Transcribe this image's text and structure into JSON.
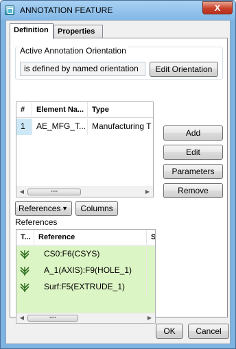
{
  "window": {
    "title": "ANNOTATION FEATURE",
    "close_label": "X"
  },
  "tabs": [
    {
      "label": "Definition",
      "active": true
    },
    {
      "label": "Properties",
      "active": false
    }
  ],
  "orientation": {
    "group_label": "Active Annotation Orientation",
    "value": "is defined by named orientation",
    "edit_button": "Edit Orientation"
  },
  "elements_table": {
    "columns": [
      "#",
      "Element Na...",
      "Type"
    ],
    "rows": [
      {
        "num": "1",
        "name": "AE_MFG_T...",
        "type": "Manufacturing T"
      }
    ]
  },
  "element_actions": {
    "add": "Add",
    "edit": "Edit",
    "parameters": "Parameters",
    "remove": "Remove"
  },
  "toolbar": {
    "references_dropdown": "References",
    "columns_button": "Columns"
  },
  "references_section": {
    "label": "References",
    "columns": [
      "T...",
      "Reference",
      "S"
    ],
    "rows": [
      {
        "icon": "datum-reference-icon",
        "reference": "CS0:F6(CSYS)"
      },
      {
        "icon": "datum-reference-icon",
        "reference": "A_1(AXIS):F9(HOLE_1)"
      },
      {
        "icon": "datum-reference-icon",
        "reference": "Surf:F5(EXTRUDE_1)"
      }
    ],
    "row_color": "#dcf5c4"
  },
  "footer": {
    "ok": "OK",
    "cancel": "Cancel"
  }
}
